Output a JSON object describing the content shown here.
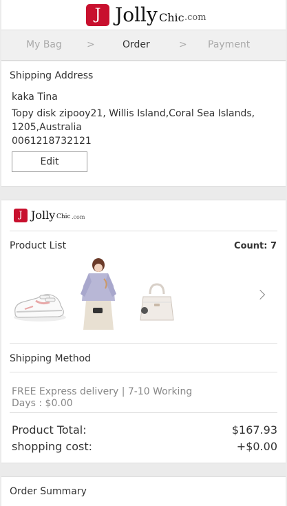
{
  "header": {
    "logo_letter": "J",
    "logo_main": "Jolly",
    "logo_sub": "Chic",
    "logo_tld": ".com"
  },
  "steps": {
    "bag": "My Bag",
    "sep1": ">",
    "order": "Order",
    "sep2": ">",
    "payment": "Payment"
  },
  "shipping_address": {
    "title": "Shipping Address",
    "name": "kaka Tina",
    "line1": "Topy disk zipooy21, Willis Island,Coral Sea Islands,",
    "line2": "1205,Australia",
    "phone": "0061218732121",
    "edit_label": "Edit"
  },
  "store": {
    "logo_letter": "J",
    "logo_main": "Jolly",
    "logo_sub": "Chic",
    "logo_tld": ".com"
  },
  "product_list": {
    "title": "Product List",
    "count_label": "Count: 7",
    "items": [
      {
        "icon": "sneaker-image"
      },
      {
        "icon": "blouse-image"
      },
      {
        "icon": "handbag-image"
      }
    ]
  },
  "shipping_method": {
    "title": "Shipping Method",
    "text": "FREE Express delivery | 7-10 Working Days : $0.00"
  },
  "totals": {
    "product_total_label": "Product Total:",
    "product_total_value": "$167.93",
    "shipping_label": "shopping cost:",
    "shipping_value": "+$0.00"
  },
  "order_summary": {
    "title": "Order Summary"
  },
  "colors": {
    "brand": "#c8102e",
    "background": "#ebebeb"
  }
}
